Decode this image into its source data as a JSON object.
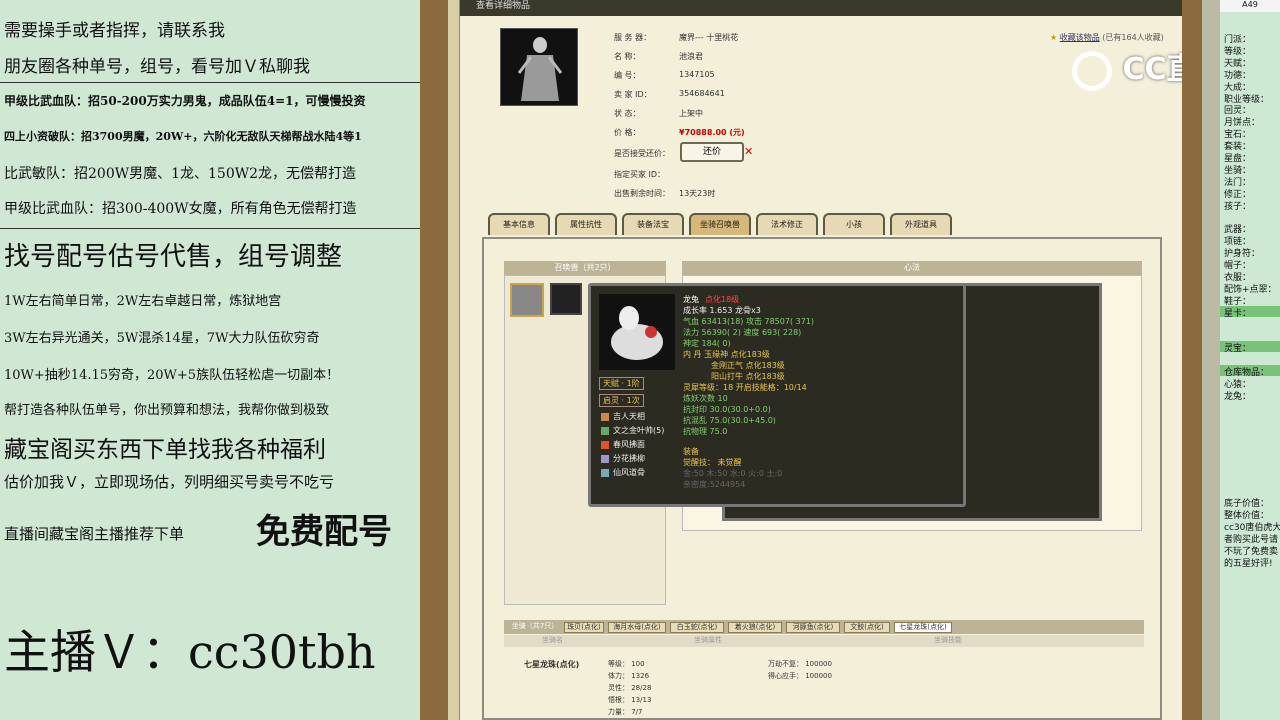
{
  "left_panel": {
    "lines": [
      "需要操手或者指挥，请联系我",
      "朋友圈各种单号，组号，看号加Ｖ私聊我",
      "甲级比武血队：招50-200万实力男鬼，成品队伍4=1，可慢慢投资",
      "四上小资破队：招3700男魔，20W+，六阶化无敌队天梯帮战水陆4等1",
      "比武敏队：招200W男魔、1龙、150W2龙，无偿帮打造",
      "甲级比武血队：招300-400W女魔，所有角色无偿帮打造",
      "找号配号估号代售，组号调整",
      "1W左右简单日常，2W左右卓越日常，炼狱地宫",
      "3W左右异光通关，5W混杀14星，7W大力队伍砍穷奇",
      "10W+抽秒14.15穷奇，20W+5族队伍轻松虐一切副本！",
      "帮打造各种队伍单号，你出预算和想法，我帮你做到极致",
      "藏宝阁买东西下单找我各种福利",
      "估价加我Ｖ，立即现场估，列明细买号卖号不吃亏",
      "直播间藏宝阁主播推荐下单",
      "免费配号",
      "主播Ｖ：cc30tbh"
    ]
  },
  "window": {
    "title": "查看详细物品",
    "favorite": "收藏该物品",
    "favorite_count": "(已有164人收藏)",
    "info": {
      "server_label": "服 务 器：",
      "server_value": "魔界--- 十里桃花",
      "name_label": "名      称：",
      "name_value": "池浪君",
      "id_label": "编      号：",
      "id_value": "1347105",
      "seller_label": "卖 家   ID：",
      "seller_value": "354684641",
      "status_label": "状      态：",
      "status_value": "上架中",
      "price_label": "价      格：",
      "price_value": "¥70888.00 (元)",
      "bargain_label": "是否接受还价：",
      "bargain_button": "还价",
      "buyer_label": "指定买家 ID：",
      "time_label": "出售剩余时间：",
      "time_value": "13天23时"
    },
    "tabs": [
      "基本信息",
      "属性抗性",
      "装备法宝",
      "坐骑召唤兽",
      "法术修正",
      "小孩",
      "外观道具"
    ],
    "active_tab": "坐骑召唤兽",
    "summon_header": "召唤兽（共2只）",
    "heart_header": "心法",
    "popup": {
      "name": "龙兔",
      "tag": "点化18级",
      "growth": "成长率 1.653  龙骨x3",
      "hp": "气血 63413(18)  攻击 78507( 371)",
      "mp": "法力 56390( 2)  速度 693( 228)",
      "loyal": "神定 184( 0)",
      "inner": "内   丹  玉缘神 点化183级",
      "inner2": "金刚正气 点化183级",
      "inner3": "阳山打牛 点化183级",
      "level": "灵犀等级：18  开启技能格：10/14",
      "refine": "炼妖次数 10",
      "res1": "抗封印 30.0(30.0+0.0)",
      "res2": "抗混乱 75.0(30.0+45.0)",
      "res3": "抗物理 75.0",
      "equip": "装备",
      "awaken": "觉醒技：  未觉醒",
      "elem": "金:50 木:50 水:0 火:0 土:0",
      "exp": "亲密度:5244954",
      "talent": "天赋 · 1阶",
      "enlighten": "启灵 · 1次",
      "skills": [
        "吉人天相",
        "文之金叶帅(5)",
        "春风拂面",
        "分花拂柳",
        "仙风道骨"
      ]
    },
    "mount_tabs": [
      "坐骑（共7只）",
      "珠贝(点化)",
      "海月水母(点化)",
      "白玉蛇(点化)",
      "着火狼(点化)",
      "河豚鱼(点化)",
      "文鲛(点化)",
      "七星龙珠(点化)"
    ],
    "mount_cols": [
      "坐骑名",
      "坐骑属性",
      "坐骑技能"
    ],
    "mount": {
      "name": "七星龙珠(点化)",
      "stats": [
        "等级：   100",
        "体力：   1326",
        "灵性：   28/28",
        "悟根：   13/13",
        "力量：   7/7"
      ],
      "skills": [
        "万劫不复：   100000",
        "得心应手：   100000"
      ]
    }
  },
  "watermark": "CC直播",
  "right_panel": {
    "cell": "A49",
    "rows": [
      "门派：",
      "等级：",
      "天赋：",
      "功德：",
      "大成：",
      "职业等级：",
      "回灵：",
      "月饼点：",
      "宝石：",
      "套装：",
      "星盘：",
      "坐骑：",
      "法门：",
      "修正：",
      "孩子：",
      "",
      "武器：",
      "项链：",
      "护身符：",
      "帽子：",
      "衣服：",
      "配饰+点翠：",
      "鞋子：",
      "星卡：",
      "",
      "",
      "灵宝：",
      "",
      "仓库物品：",
      "心猿：",
      "龙兔：",
      "",
      "",
      "",
      "",
      "",
      "",
      "",
      "",
      "底子价值：",
      "整体价值：",
      "cc30唐伯虎大",
      "者购买此号请",
      "不玩了免费卖",
      "的五星好评!"
    ],
    "highlight_rows": [
      23,
      26,
      28
    ]
  }
}
